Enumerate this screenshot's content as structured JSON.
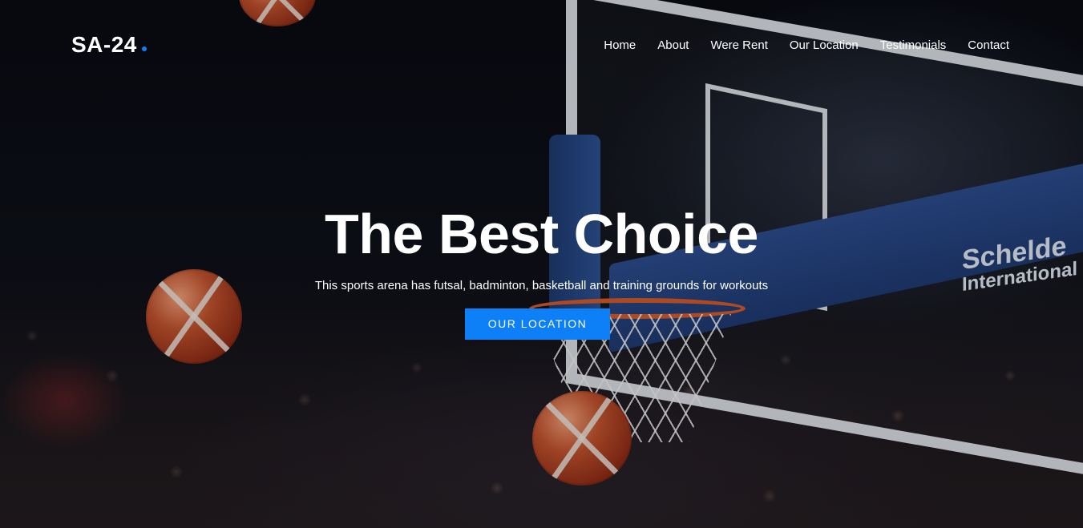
{
  "brand": {
    "name": "SA-24",
    "accent_color": "#0d7ff7"
  },
  "nav": {
    "items": [
      "Home",
      "About",
      "Were Rent",
      "Our Location",
      "Testimonials",
      "Contact"
    ]
  },
  "hero": {
    "title": "The Best Choice",
    "subtitle": "This sports arena has futsal, badminton, basketball and training grounds for workouts",
    "cta_label": "OUR LOCATION",
    "backdrop_sponsor_line1": "Schelde",
    "backdrop_sponsor_line2": "International"
  }
}
